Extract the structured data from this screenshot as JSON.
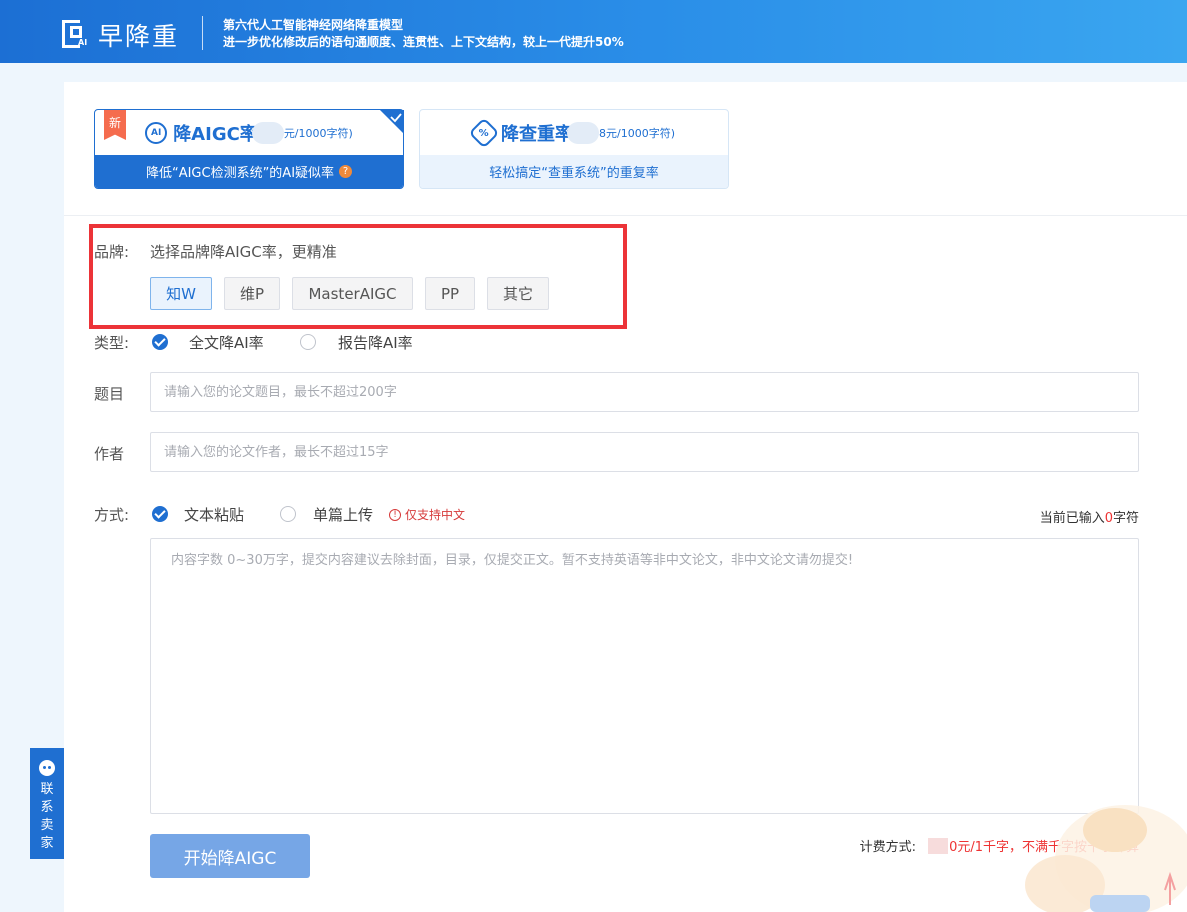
{
  "header": {
    "logo_text": "早降重",
    "logo_badge": "AI",
    "slogan_line1": "第六代人工智能神经网络降重模型",
    "slogan_line2": "进一步优化修改后的语句通顺度、连贯性、上下文结构，较上一代提升50%"
  },
  "tabs": [
    {
      "badge": "新",
      "icon_text": "AI",
      "title": "降AIGC率",
      "price_suffix": "元/1000字符)",
      "subtitle": "降低“AIGC检测系统”的AI疑似率",
      "help": "?"
    },
    {
      "icon_text": "%",
      "title": "降查重率",
      "price_suffix": "8元/1000字符)",
      "subtitle": "轻松搞定“查重系统”的重复率"
    }
  ],
  "form": {
    "brand_label": "品牌:",
    "brand_hint": "选择品牌降AIGC率，更精准",
    "brands": [
      "知W",
      "维P",
      "MasterAIGC",
      "PP",
      "其它"
    ],
    "type_label": "类型:",
    "type_options": [
      "全文降AI率",
      "报告降AI率"
    ],
    "title_label": "题目",
    "title_placeholder": "请输入您的论文题目，最长不超过200字",
    "author_label": "作者",
    "author_placeholder": "请输入您的论文作者，最长不超过15字",
    "mode_label": "方式:",
    "mode_options": [
      "文本粘贴",
      "单篇上传"
    ],
    "warn_icon": "!",
    "mode_warning": "仅支持中文",
    "counter_prefix": "当前已输入",
    "counter_value": "0",
    "counter_suffix": "字符",
    "content_placeholder": "内容字数 0~30万字，提交内容建议去除封面，目录，仅提交正文。暂不支持英语等非中文论文，非中文论文请勿提交!",
    "start_button": "开始降AIGC",
    "pricing_label": "计费方式:",
    "pricing_value": "0元/1千字，不满千字按千字计算"
  },
  "contact": {
    "label_chars": [
      "联",
      "系",
      "卖",
      "家"
    ]
  },
  "colors": {
    "primary": "#1f6fd1",
    "highlight": "#ec3338",
    "warning": "#d63a3a"
  }
}
